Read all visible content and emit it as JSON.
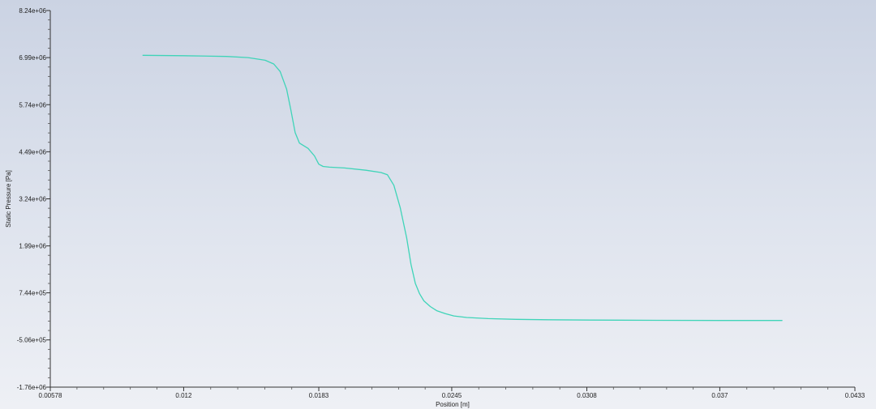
{
  "chart_data": {
    "type": "line",
    "title": "",
    "xlabel": "Position [m]",
    "ylabel": "Static Pressure [Pa]",
    "xlim": [
      0.00578,
      0.0433
    ],
    "ylim": [
      -1760000,
      8240000
    ],
    "x_ticks": [
      0.00578,
      0.012,
      0.0183,
      0.0245,
      0.0308,
      0.037,
      0.0433
    ],
    "x_tick_labels": [
      "0.00578",
      "0.012",
      "0.0183",
      "0.0245",
      "0.0308",
      "0.037",
      "0.0433"
    ],
    "y_ticks": [
      -1760000,
      -506000,
      744000,
      1990000,
      3240000,
      4490000,
      5740000,
      6990000,
      8240000
    ],
    "y_tick_labels": [
      "-1.76e+06",
      "-5.06e+05",
      "7.44e+05",
      "1.99e+06",
      "3.24e+06",
      "4.49e+06",
      "5.74e+06",
      "6.99e+06",
      "8.24e+06"
    ],
    "grid": false,
    "line_color": "#3fd4b8",
    "series": [
      {
        "x": [
          0.0101,
          0.012,
          0.014,
          0.015,
          0.0158,
          0.0162,
          0.0165,
          0.0168,
          0.017,
          0.0172,
          0.0174,
          0.0176,
          0.0178,
          0.0181,
          0.0183,
          0.0185,
          0.0188,
          0.0195,
          0.0205,
          0.0212,
          0.0215,
          0.0218,
          0.0221,
          0.0224,
          0.0226,
          0.0228,
          0.023,
          0.0232,
          0.0235,
          0.0238,
          0.0242,
          0.0246,
          0.0252,
          0.0262,
          0.0275,
          0.029,
          0.031,
          0.034,
          0.037,
          0.0399
        ],
        "y": [
          7050000,
          7040000,
          7020000,
          6990000,
          6920000,
          6820000,
          6620000,
          6150000,
          5600000,
          5000000,
          4720000,
          4650000,
          4580000,
          4380000,
          4160000,
          4100000,
          4080000,
          4060000,
          4000000,
          3940000,
          3880000,
          3600000,
          3000000,
          2200000,
          1500000,
          1000000,
          720000,
          530000,
          380000,
          270000,
          190000,
          130000,
          90000,
          60000,
          40000,
          30000,
          20000,
          15000,
          10000,
          10000
        ]
      }
    ]
  }
}
